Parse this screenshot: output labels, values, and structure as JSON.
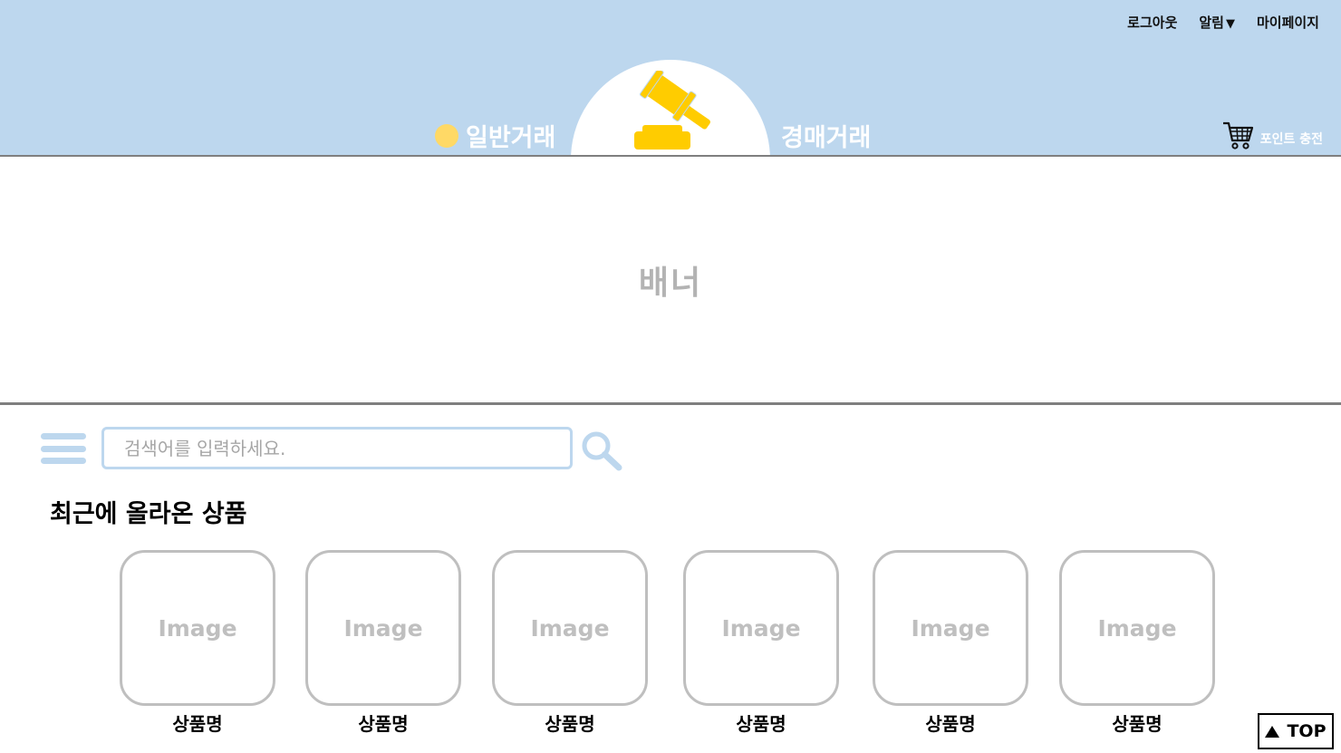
{
  "header": {
    "top_links": {
      "logout": "로그아웃",
      "alarm": "알림",
      "alarm_arrow": "▼",
      "mypage": "마이페이지"
    },
    "nav": {
      "general_trade": "일반거래",
      "auction_trade": "경매거래"
    },
    "point_charge": "포인트 충전",
    "icons": [
      "sun-icon",
      "gavel-logo",
      "moon-icon",
      "cart-icon"
    ]
  },
  "banner": {
    "text": "배너"
  },
  "search": {
    "placeholder": "검색어를 입력하세요.",
    "value": ""
  },
  "recent_products": {
    "title": "최근에 올라온 상품",
    "items": [
      {
        "image_label": "Image",
        "name": "상품명"
      },
      {
        "image_label": "Image",
        "name": "상품명"
      },
      {
        "image_label": "Image",
        "name": "상품명"
      },
      {
        "image_label": "Image",
        "name": "상품명"
      },
      {
        "image_label": "Image",
        "name": "상품명"
      },
      {
        "image_label": "Image",
        "name": "상품명"
      }
    ]
  },
  "top_button": {
    "label": "TOP"
  },
  "colors": {
    "header_bg": "#bdd7ee",
    "accent_yellow": "#ffcc00",
    "placeholder_gray": "#bfbfbf",
    "divider_gray": "#7f7f7f"
  }
}
